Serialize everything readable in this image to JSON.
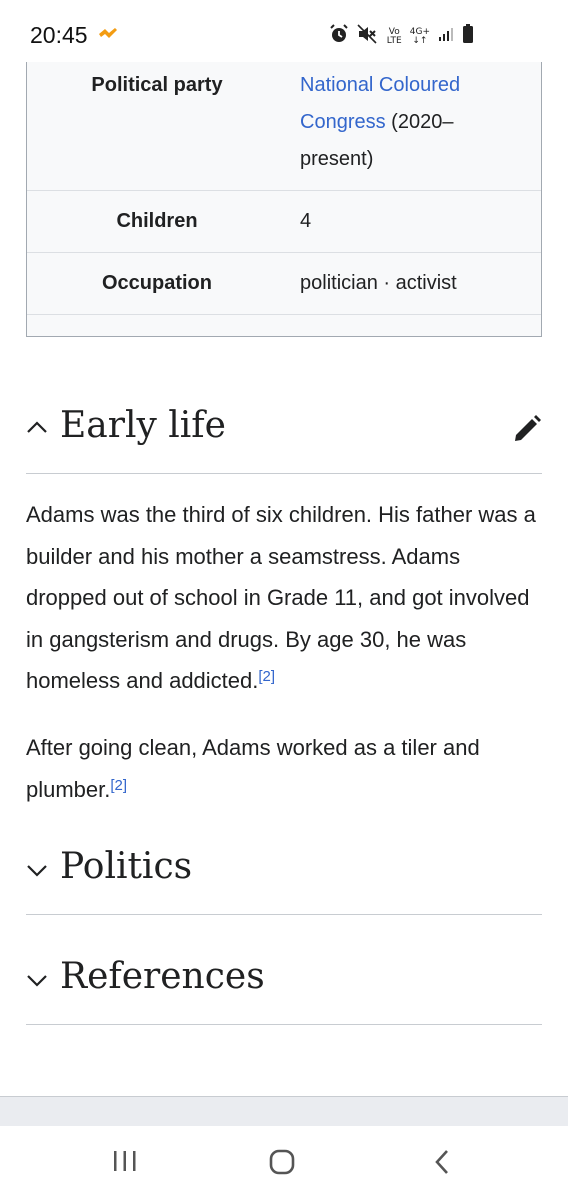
{
  "status_bar": {
    "time": "20:45",
    "vo_lte": [
      "Vo",
      "LTE"
    ],
    "network": "4G+",
    "icons": [
      "wear-os-icon",
      "alarm-icon",
      "mute-icon",
      "signal-icon",
      "battery-icon"
    ]
  },
  "infobox": {
    "rows": [
      {
        "label": "Political party",
        "value_link": "National Coloured Congress",
        "value_rest": " (2020–present)"
      },
      {
        "label": "Children",
        "value": "4"
      },
      {
        "label": "Occupation",
        "value": "politician · activist"
      }
    ]
  },
  "sections": {
    "early_life": {
      "title": "Early life",
      "paragraph1": "Adams was the third of six children. His father was a builder and his mother a seamstress. Adams dropped out of school in Grade 11, and got involved in gangsterism and drugs. By age 30, he was homeless and addicted.",
      "paragraph1_ref": "[2]",
      "paragraph2": "After going clean, Adams worked as a tiler and plumber.",
      "paragraph2_ref": "[2]"
    },
    "politics": {
      "title": "Politics"
    },
    "references": {
      "title": "References"
    }
  },
  "colors": {
    "link": "#3366cc",
    "text": "#202122",
    "infobox_bg": "#f8f9fa",
    "wear_icon": "#f39c12"
  },
  "nav_bar": {
    "icons": [
      "recent-apps-icon",
      "home-icon",
      "back-icon"
    ]
  }
}
